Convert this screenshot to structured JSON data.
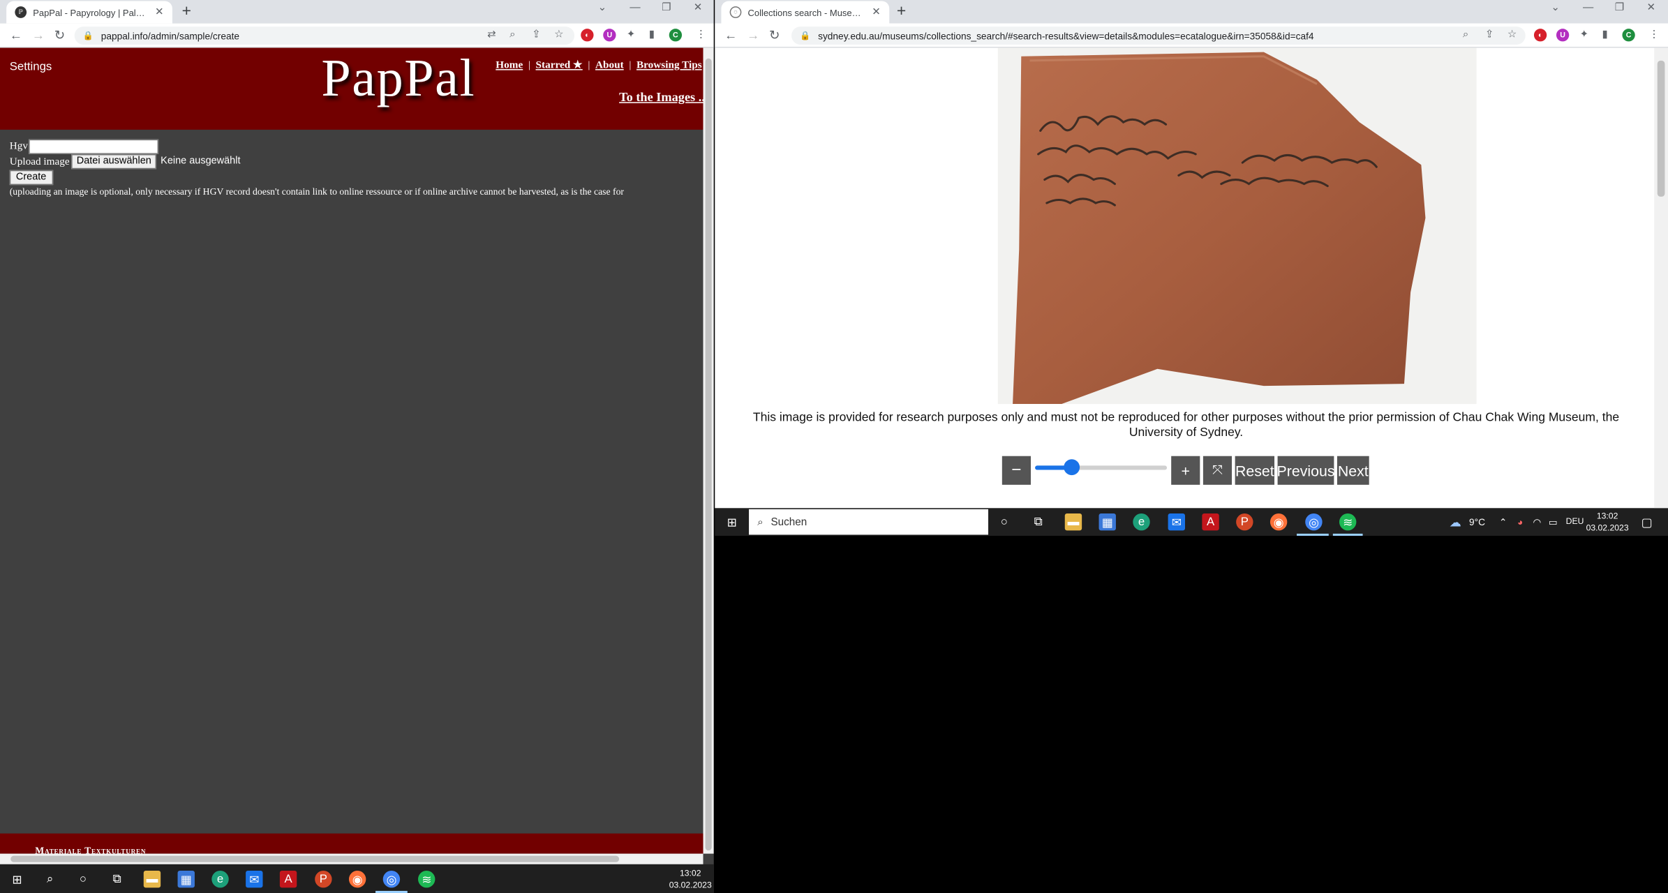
{
  "left_browser": {
    "tab_title": "PapPal - Papyrology | Paleography",
    "url": "pappal.info/admin/sample/create",
    "profile_initial": "C"
  },
  "pappal": {
    "settings": "Settings",
    "logo": "PapPal",
    "nav": [
      "Home",
      "Starred ★",
      "About",
      "Browsing Tips"
    ],
    "to_images": "To the Images ...",
    "form": {
      "hgv_label": "Hgv",
      "upload_label": "Upload image",
      "file_button": "Datei auswählen",
      "file_status": "Keine ausgewählt",
      "create_button": "Create",
      "note": "(uploading an image is optional, only necessary if HGV record doesn't contain link to online ressource or if online archive cannot be harvested, as is the case for"
    },
    "footer": "Materiale Textkulturen"
  },
  "right_browser": {
    "tab_title": "Collections search - Museums - The University of Sydney",
    "url": "sydney.edu.au/museums/collections_search/#search-results&view=details&modules=ecatalogue&irn=35058&id=caf4",
    "profile_initial": "C"
  },
  "viewer": {
    "caption": "This image is provided for research purposes only and must not be reproduced for other purposes without the prior permission of Chau Chak Wing Museum, the University of Sydney.",
    "zoom_out": "−",
    "zoom_in": "+",
    "fit_icon": "⤧",
    "reset": "Reset",
    "previous": "Previous",
    "next": "Next",
    "zoom_level": 0.28
  },
  "taskbar_right": {
    "search_placeholder": "Suchen",
    "weather": "9°C",
    "language": "DEU",
    "time": "13:02",
    "date": "03.02.2023"
  },
  "taskbar_left": {
    "time": "13:02",
    "date": "03.02.2023"
  },
  "colors": {
    "pappal_red": "#720000",
    "page_gray": "#404040",
    "slider_blue": "#1a73e8",
    "button_gray": "#555555"
  }
}
